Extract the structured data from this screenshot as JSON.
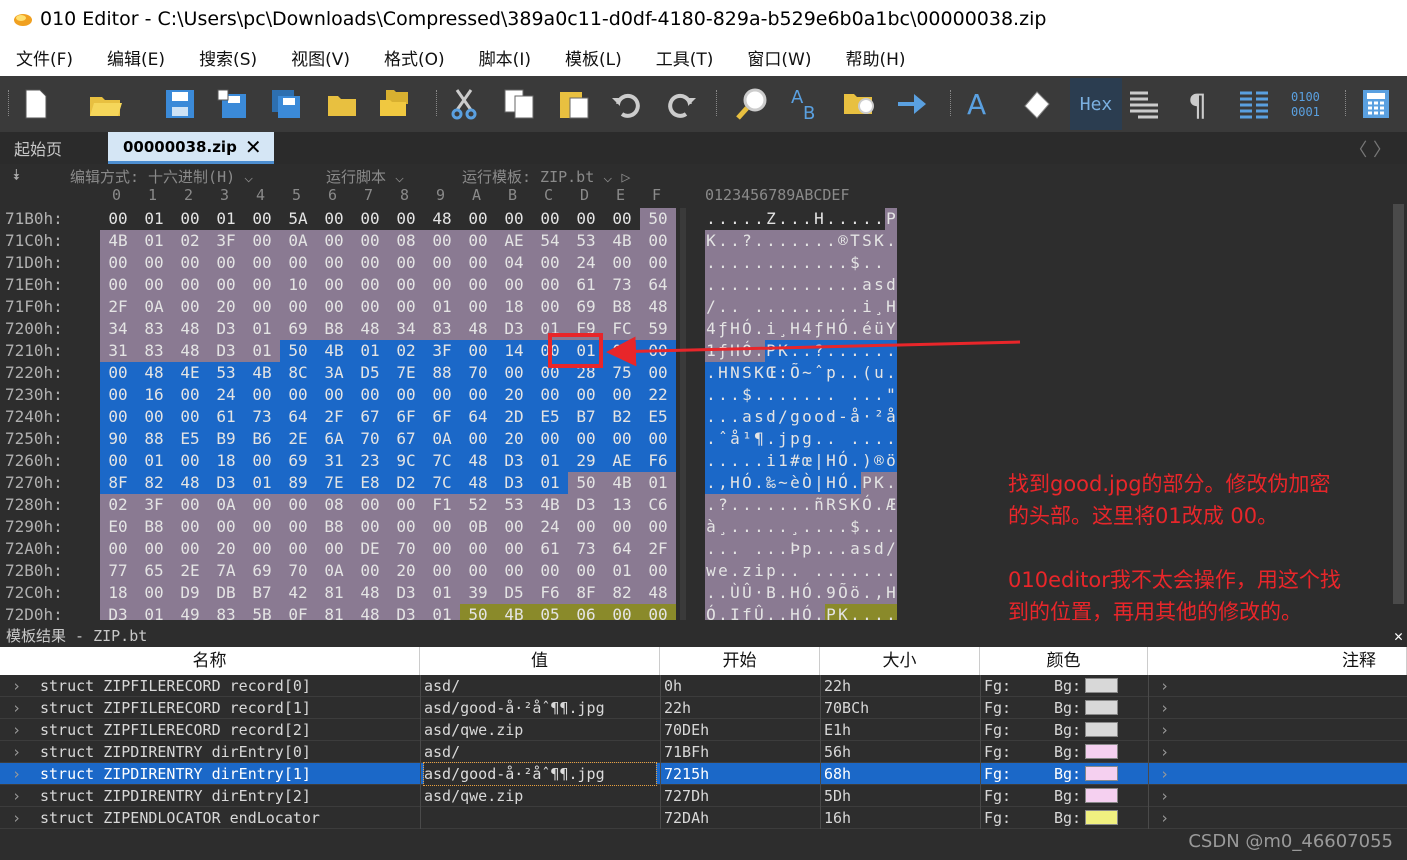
{
  "title": "010 Editor - C:\\Users\\pc\\Downloads\\Compressed\\389a0c11-d0df-4180-829a-b529e6b0a1bc\\00000038.zip",
  "menu": [
    "文件(F)",
    "编辑(E)",
    "搜索(S)",
    "视图(V)",
    "格式(O)",
    "脚本(I)",
    "模板(L)",
    "工具(T)",
    "窗口(W)",
    "帮助(H)"
  ],
  "toolbar": {
    "icons": [
      "new-file-icon",
      "open-folder-icon",
      "save-icon",
      "save-as-icon",
      "save-all-icon",
      "folder-icon",
      "folders-icon",
      "cut-icon",
      "copy-icon",
      "paste-icon",
      "undo-icon",
      "redo-icon",
      "find-icon",
      "replace-icon",
      "find-in-files-icon",
      "goto-icon",
      "font-icon",
      "highlight-icon",
      "compare-icon",
      "show-whitespace-icon",
      "columns-icon",
      "binary-icon",
      "calculator-icon"
    ],
    "hex_label": "Hex"
  },
  "tabs": {
    "start": "起始页",
    "file": "00000038.zip",
    "close": "✕",
    "nav": "〈 〉"
  },
  "editor_bar": {
    "edit_mode": "编辑方式: 十六进制(H) ⌵",
    "run_script": "运行脚本 ⌵",
    "run_template": "运行模板: ZIP.bt ⌵ ▷"
  },
  "hex_header": {
    "columns": [
      "0",
      "1",
      "2",
      "3",
      "4",
      "5",
      "6",
      "7",
      "8",
      "9",
      "A",
      "B",
      "C",
      "D",
      "E",
      "F"
    ],
    "ascii": "0123456789ABCDEF"
  },
  "hex_rows": [
    {
      "addr": "71B0h:",
      "bytes": [
        "00",
        "01",
        "00",
        "01",
        "00",
        "5A",
        "00",
        "00",
        "00",
        "48",
        "00",
        "00",
        "00",
        "00",
        "00",
        "50"
      ],
      "ascii": ".....Z...H.....P"
    },
    {
      "addr": "71C0h:",
      "bytes": [
        "4B",
        "01",
        "02",
        "3F",
        "00",
        "0A",
        "00",
        "00",
        "08",
        "00",
        "00",
        "AE",
        "54",
        "53",
        "4B",
        "00"
      ],
      "ascii": "K..?.......®TSK."
    },
    {
      "addr": "71D0h:",
      "bytes": [
        "00",
        "00",
        "00",
        "00",
        "00",
        "00",
        "00",
        "00",
        "00",
        "00",
        "00",
        "04",
        "00",
        "24",
        "00",
        "00"
      ],
      "ascii": "............$.."
    },
    {
      "addr": "71E0h:",
      "bytes": [
        "00",
        "00",
        "00",
        "00",
        "00",
        "10",
        "00",
        "00",
        "00",
        "00",
        "00",
        "00",
        "00",
        "61",
        "73",
        "64"
      ],
      "ascii": ".............asd"
    },
    {
      "addr": "71F0h:",
      "bytes": [
        "2F",
        "0A",
        "00",
        "20",
        "00",
        "00",
        "00",
        "00",
        "00",
        "01",
        "00",
        "18",
        "00",
        "69",
        "B8",
        "48"
      ],
      "ascii": "/.. .........i¸H"
    },
    {
      "addr": "7200h:",
      "bytes": [
        "34",
        "83",
        "48",
        "D3",
        "01",
        "69",
        "B8",
        "48",
        "34",
        "83",
        "48",
        "D3",
        "01",
        "F9",
        "FC",
        "59"
      ],
      "ascii": "4ƒHÓ.i¸H4ƒHÓ.éüY"
    },
    {
      "addr": "7210h:",
      "bytes": [
        "31",
        "83",
        "48",
        "D3",
        "01",
        "50",
        "4B",
        "01",
        "02",
        "3F",
        "00",
        "14",
        "00",
        "01",
        "08",
        "00"
      ],
      "ascii": "1ƒHÓ.PK..?......"
    },
    {
      "addr": "7220h:",
      "bytes": [
        "00",
        "48",
        "4E",
        "53",
        "4B",
        "8C",
        "3A",
        "D5",
        "7E",
        "88",
        "70",
        "00",
        "00",
        "28",
        "75",
        "00"
      ],
      "ascii": ".HNSKŒ:Õ~ˆp..(u."
    },
    {
      "addr": "7230h:",
      "bytes": [
        "00",
        "16",
        "00",
        "24",
        "00",
        "00",
        "00",
        "00",
        "00",
        "00",
        "00",
        "20",
        "00",
        "00",
        "00",
        "22"
      ],
      "ascii": "...$....... ...\""
    },
    {
      "addr": "7240h:",
      "bytes": [
        "00",
        "00",
        "00",
        "61",
        "73",
        "64",
        "2F",
        "67",
        "6F",
        "6F",
        "64",
        "2D",
        "E5",
        "B7",
        "B2",
        "E5"
      ],
      "ascii": "...asd/good-å·²å"
    },
    {
      "addr": "7250h:",
      "bytes": [
        "90",
        "88",
        "E5",
        "B9",
        "B6",
        "2E",
        "6A",
        "70",
        "67",
        "0A",
        "00",
        "20",
        "00",
        "00",
        "00",
        "00"
      ],
      "ascii": ".ˆå¹¶.jpg.. ...."
    },
    {
      "addr": "7260h:",
      "bytes": [
        "00",
        "01",
        "00",
        "18",
        "00",
        "69",
        "31",
        "23",
        "9C",
        "7C",
        "48",
        "D3",
        "01",
        "29",
        "AE",
        "F6"
      ],
      "ascii": ".....i1#œ|HÓ.)®ö"
    },
    {
      "addr": "7270h:",
      "bytes": [
        "8F",
        "82",
        "48",
        "D3",
        "01",
        "89",
        "7E",
        "E8",
        "D2",
        "7C",
        "48",
        "D3",
        "01",
        "50",
        "4B",
        "01"
      ],
      "ascii": ".‚HÓ.‰~èÒ|HÓ.PK."
    },
    {
      "addr": "7280h:",
      "bytes": [
        "02",
        "3F",
        "00",
        "0A",
        "00",
        "00",
        "08",
        "00",
        "00",
        "F1",
        "52",
        "53",
        "4B",
        "D3",
        "13",
        "C6"
      ],
      "ascii": ".?.......ñRSKÓ.Æ"
    },
    {
      "addr": "7290h:",
      "bytes": [
        "E0",
        "B8",
        "00",
        "00",
        "00",
        "00",
        "B8",
        "00",
        "00",
        "00",
        "0B",
        "00",
        "24",
        "00",
        "00",
        "00"
      ],
      "ascii": "à¸.....¸....$..."
    },
    {
      "addr": "72A0h:",
      "bytes": [
        "00",
        "00",
        "00",
        "20",
        "00",
        "00",
        "00",
        "DE",
        "70",
        "00",
        "00",
        "00",
        "61",
        "73",
        "64",
        "2F"
      ],
      "ascii": "... ...Þp...asd/"
    },
    {
      "addr": "72B0h:",
      "bytes": [
        "77",
        "65",
        "2E",
        "7A",
        "69",
        "70",
        "0A",
        "00",
        "20",
        "00",
        "00",
        "00",
        "00",
        "00",
        "01",
        "00"
      ],
      "ascii": "we.zip.. ......."
    },
    {
      "addr": "72C0h:",
      "bytes": [
        "18",
        "00",
        "D9",
        "DB",
        "B7",
        "42",
        "81",
        "48",
        "D3",
        "01",
        "39",
        "D5",
        "F6",
        "8F",
        "82",
        "48"
      ],
      "ascii": "..ÙÛ·B.HÓ.9Õö.‚H"
    },
    {
      "addr": "72D0h:",
      "bytes": [
        "D3",
        "01",
        "49",
        "83",
        "5B",
        "0F",
        "81",
        "48",
        "D3",
        "01",
        "50",
        "4B",
        "05",
        "06",
        "00",
        "00"
      ],
      "ascii": "Ó.IƒÛ..HÓ.PK...."
    }
  ],
  "colors": {
    "purple": "#8a7a92",
    "blue": "#1b68c8",
    "olive": "#8a8a2a",
    "annotation_red": "#e8262a"
  },
  "annotation": {
    "line1": "找到good.jpg的部分。修改伪加密",
    "line2": "的头部。这里将01改成 00。",
    "line3": "010editor我不太会操作，用这个找",
    "line4": "到的位置，再用其他的修改的。"
  },
  "template_panel": {
    "title": "模板结果 - ZIP.bt",
    "close": "✕",
    "headers": {
      "name": "名称",
      "value": "值",
      "start": "开始",
      "size": "大小",
      "color": "颜色",
      "comment": "注释"
    },
    "rows": [
      {
        "name": "struct ZIPFILERECORD record[0]",
        "value": "asd/",
        "start": "0h",
        "size": "22h",
        "fg": "Fg:",
        "bg": "Bg:",
        "bgcolor": "#d8d8d8"
      },
      {
        "name": "struct ZIPFILERECORD record[1]",
        "value": "asd/good-å·²åˆ¶¶.jpg",
        "start": "22h",
        "size": "70BCh",
        "fg": "Fg:",
        "bg": "Bg:",
        "bgcolor": "#d8d8d8"
      },
      {
        "name": "struct ZIPFILERECORD record[2]",
        "value": "asd/qwe.zip",
        "start": "70DEh",
        "size": "E1h",
        "fg": "Fg:",
        "bg": "Bg:",
        "bgcolor": "#d8d8d8"
      },
      {
        "name": "struct ZIPDIRENTRY dirEntry[0]",
        "value": "asd/",
        "start": "71BFh",
        "size": "56h",
        "fg": "Fg:",
        "bg": "Bg:",
        "bgcolor": "#f5d0f0"
      },
      {
        "name": "struct ZIPDIRENTRY dirEntry[1]",
        "value": "asd/good-å·²åˆ¶¶.jpg",
        "start": "7215h",
        "size": "68h",
        "fg": "Fg:",
        "bg": "Bg:",
        "bgcolor": "#f5d0f0"
      },
      {
        "name": "struct ZIPDIRENTRY dirEntry[2]",
        "value": "asd/qwe.zip",
        "start": "727Dh",
        "size": "5Dh",
        "fg": "Fg:",
        "bg": "Bg:",
        "bgcolor": "#f5d0f0"
      },
      {
        "name": "struct ZIPENDLOCATOR endLocator",
        "value": "",
        "start": "72DAh",
        "size": "16h",
        "fg": "Fg:",
        "bg": "Bg:",
        "bgcolor": "#f0f080"
      }
    ]
  },
  "watermark": "CSDN @m0_46607055"
}
